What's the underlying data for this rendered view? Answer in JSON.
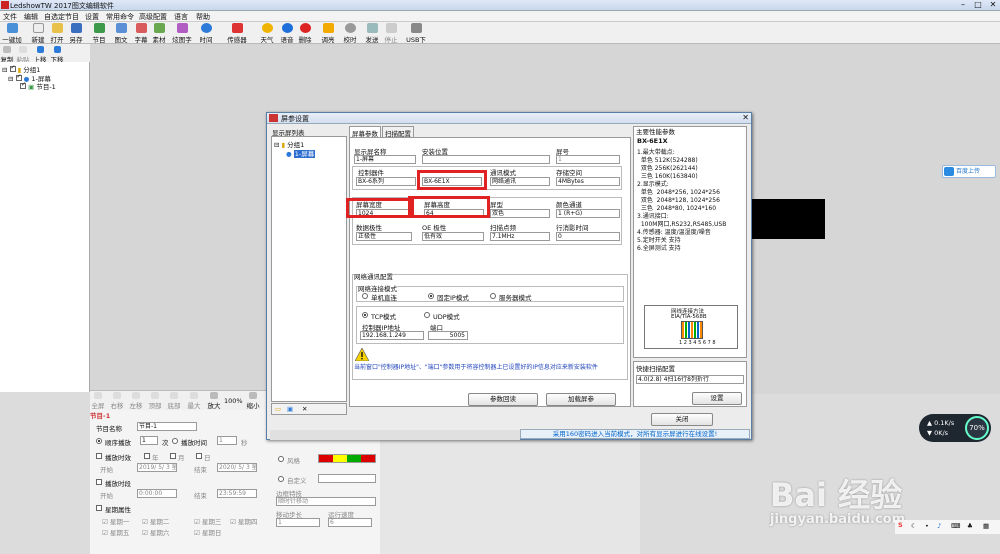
{
  "app": {
    "title": "LedshowTW 2017图文编辑软件"
  },
  "menu": [
    "文件",
    "编辑",
    "自选定节目",
    "设置",
    "常用命令",
    "高级配置",
    "语言",
    "帮助"
  ],
  "toolbar": {
    "left": [
      "一键加屏"
    ],
    "items": [
      "节目",
      "图文",
      "字幕",
      "素材",
      "炫图字",
      "时间",
      "传感器",
      "天气",
      "语音",
      "删除",
      "调亮",
      "校时",
      "发送",
      "停止",
      "USB下载"
    ]
  },
  "toolbar2": [
    "复制",
    "粘贴",
    "上移",
    "下移"
  ],
  "tree": {
    "group": "分组1",
    "screen": "1-屏幕",
    "program": "节目-1"
  },
  "bottom_tools": [
    "全屏",
    "右移",
    "左移",
    "顶部",
    "底部",
    "最大化",
    "放大",
    "100%",
    "缩小"
  ],
  "program_props": {
    "title": "节目-1",
    "name_label": "节目名称",
    "name_value": "节目-1",
    "loop_label": "顺序播放",
    "loop_count": "1",
    "loop_unit": "次",
    "time_label": "播放时间",
    "time_value": "1",
    "time_unit": "秒",
    "valid_label": "播放时效",
    "year": "年",
    "month": "月",
    "day": "日",
    "start_label": "开始",
    "start_date": "2019/ 5/ 3 星",
    "end_label": "结束",
    "end_date": "2020/ 5/ 3 星",
    "period_label": "播放时段",
    "start_time": "0:00:00",
    "end_time": "23:59:59",
    "week_label": "星期属性",
    "weekdays": [
      "星期一",
      "星期二",
      "星期三",
      "星期四",
      "星期五",
      "星期六",
      "星期日"
    ]
  },
  "mid_props": {
    "style_label": "风格",
    "custom_label": "自定义",
    "border_label": "边框特技",
    "move_label": "顺时针移动",
    "step_label": "移动步长",
    "speed_label": "运行速度",
    "step_value": "1",
    "speed_value": "6"
  },
  "dialog": {
    "title": "屏参设置",
    "screen_list_label": "显示屏列表",
    "list_group": "分组1",
    "list_screen": "1-屏幕",
    "tabs": [
      "屏幕参数",
      "扫描配置"
    ],
    "screen_name_label": "显示屏名称",
    "screen_name": "1-屏幕",
    "install_label": "安装位置",
    "install_value": "",
    "screen_no_label": "屏号",
    "screen_no": "1",
    "controller_label": "控制器件",
    "controller_series": "BX-6系列",
    "controller_model": "BX-6E1X",
    "comm_label": "通讯模式",
    "comm_value": "网络通讯",
    "storage_label": "存储空间",
    "storage_value": "4MBytes",
    "width_label": "屏幕宽度",
    "width_value": "1024",
    "height_label": "屏幕高度",
    "height_value": "64",
    "type_label": "屏型",
    "type_value": "双色",
    "color_label": "颜色通道",
    "color_value": "1 (R+G)",
    "data_pol_label": "数据极性",
    "data_pol_value": "正极性",
    "oe_label": "OE 极性",
    "oe_value": "低有效",
    "scan_freq_label": "扫描点频",
    "scan_freq_value": "7.1MHz",
    "blank_label": "行消影时间",
    "blank_value": "0",
    "net_group_label": "网络通讯配置",
    "net_mode_label": "网络连接模式",
    "net_modes": [
      "单机直连",
      "固定IP模式",
      "服务器模式"
    ],
    "tcp_label": "TCP模式",
    "udp_label": "UDP模式",
    "ip_label": "控制器IP地址",
    "ip_value": "192.168.1.249",
    "port_label": "端口",
    "port_value": "5005",
    "warning": "当前窗口\"控制器IP地址\"、\"端口\"参数用于将容控制器上已设置好的IP信息对应来新安装软件",
    "btn_read": "参数回读",
    "btn_load": "加载屏参",
    "btn_close": "关闭",
    "main_param_title": "主要性能参数",
    "model_title": "BX-6E1X",
    "params": [
      "1.最大带载点:",
      "  单色 512K(524288)",
      "  双色 256K(262144)",
      "  三色 160K(163840)",
      "2.显示模式:",
      "  单色  2048*256, 1024*256",
      "  双色  2048*128, 1024*256",
      "  三色  2048*80, 1024*160",
      "3.通讯接口:",
      "  100M网口,RS232,RS485,USB",
      "4.传感器: 温度/温湿度/噪音",
      "5.定时开关 支持",
      "6.全屏测试 支持"
    ],
    "wiring_title": "网线连接方法",
    "wiring_std": "EIA/TIA-568B",
    "wiring_pins": "1 2 3 4 5 6 7 8",
    "quick_scan_label": "快捷扫描配置",
    "quick_scan_value": "4.0(2.8) 4扫16行8列折行",
    "settings_btn": "设置"
  },
  "status_text": "采用160密码进入当前模式，对所有显示屏进行在线设置!",
  "cloud_btn": "百度上传",
  "net_speed": {
    "up": "0.1K/s",
    "down": "0K/s",
    "percent": "70%"
  },
  "watermark": {
    "brand": "Bai 经验",
    "url": "jingyan.baidu.com"
  }
}
